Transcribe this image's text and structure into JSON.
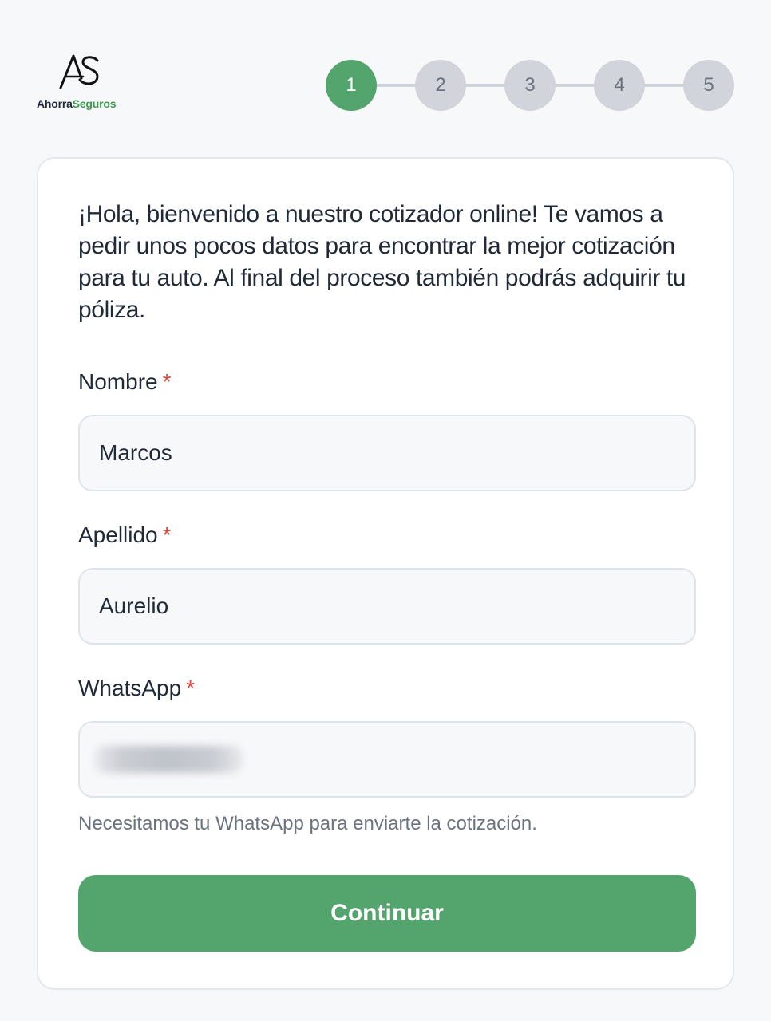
{
  "brand": {
    "logo_text_part1": "Ahorra",
    "logo_text_part2": "Seguros",
    "accent_color": "#53a46d"
  },
  "stepper": {
    "current_step": 1,
    "steps": [
      {
        "label": "1"
      },
      {
        "label": "2"
      },
      {
        "label": "3"
      },
      {
        "label": "4"
      },
      {
        "label": "5"
      }
    ]
  },
  "form": {
    "intro": "¡Hola, bienvenido a nuestro cotizador online! Te vamos a pedir unos pocos datos para encontrar la mejor cotización para tu auto. Al final del proceso también podrás adquirir tu póliza.",
    "required_mark": "*",
    "fields": {
      "nombre": {
        "label": "Nombre",
        "value": "Marcos"
      },
      "apellido": {
        "label": "Apellido",
        "value": "Aurelio"
      },
      "whatsapp": {
        "label": "WhatsApp",
        "value_redacted": true
      }
    },
    "hint": "Necesitamos tu WhatsApp para enviarte la cotización.",
    "submit_label": "Continuar"
  }
}
